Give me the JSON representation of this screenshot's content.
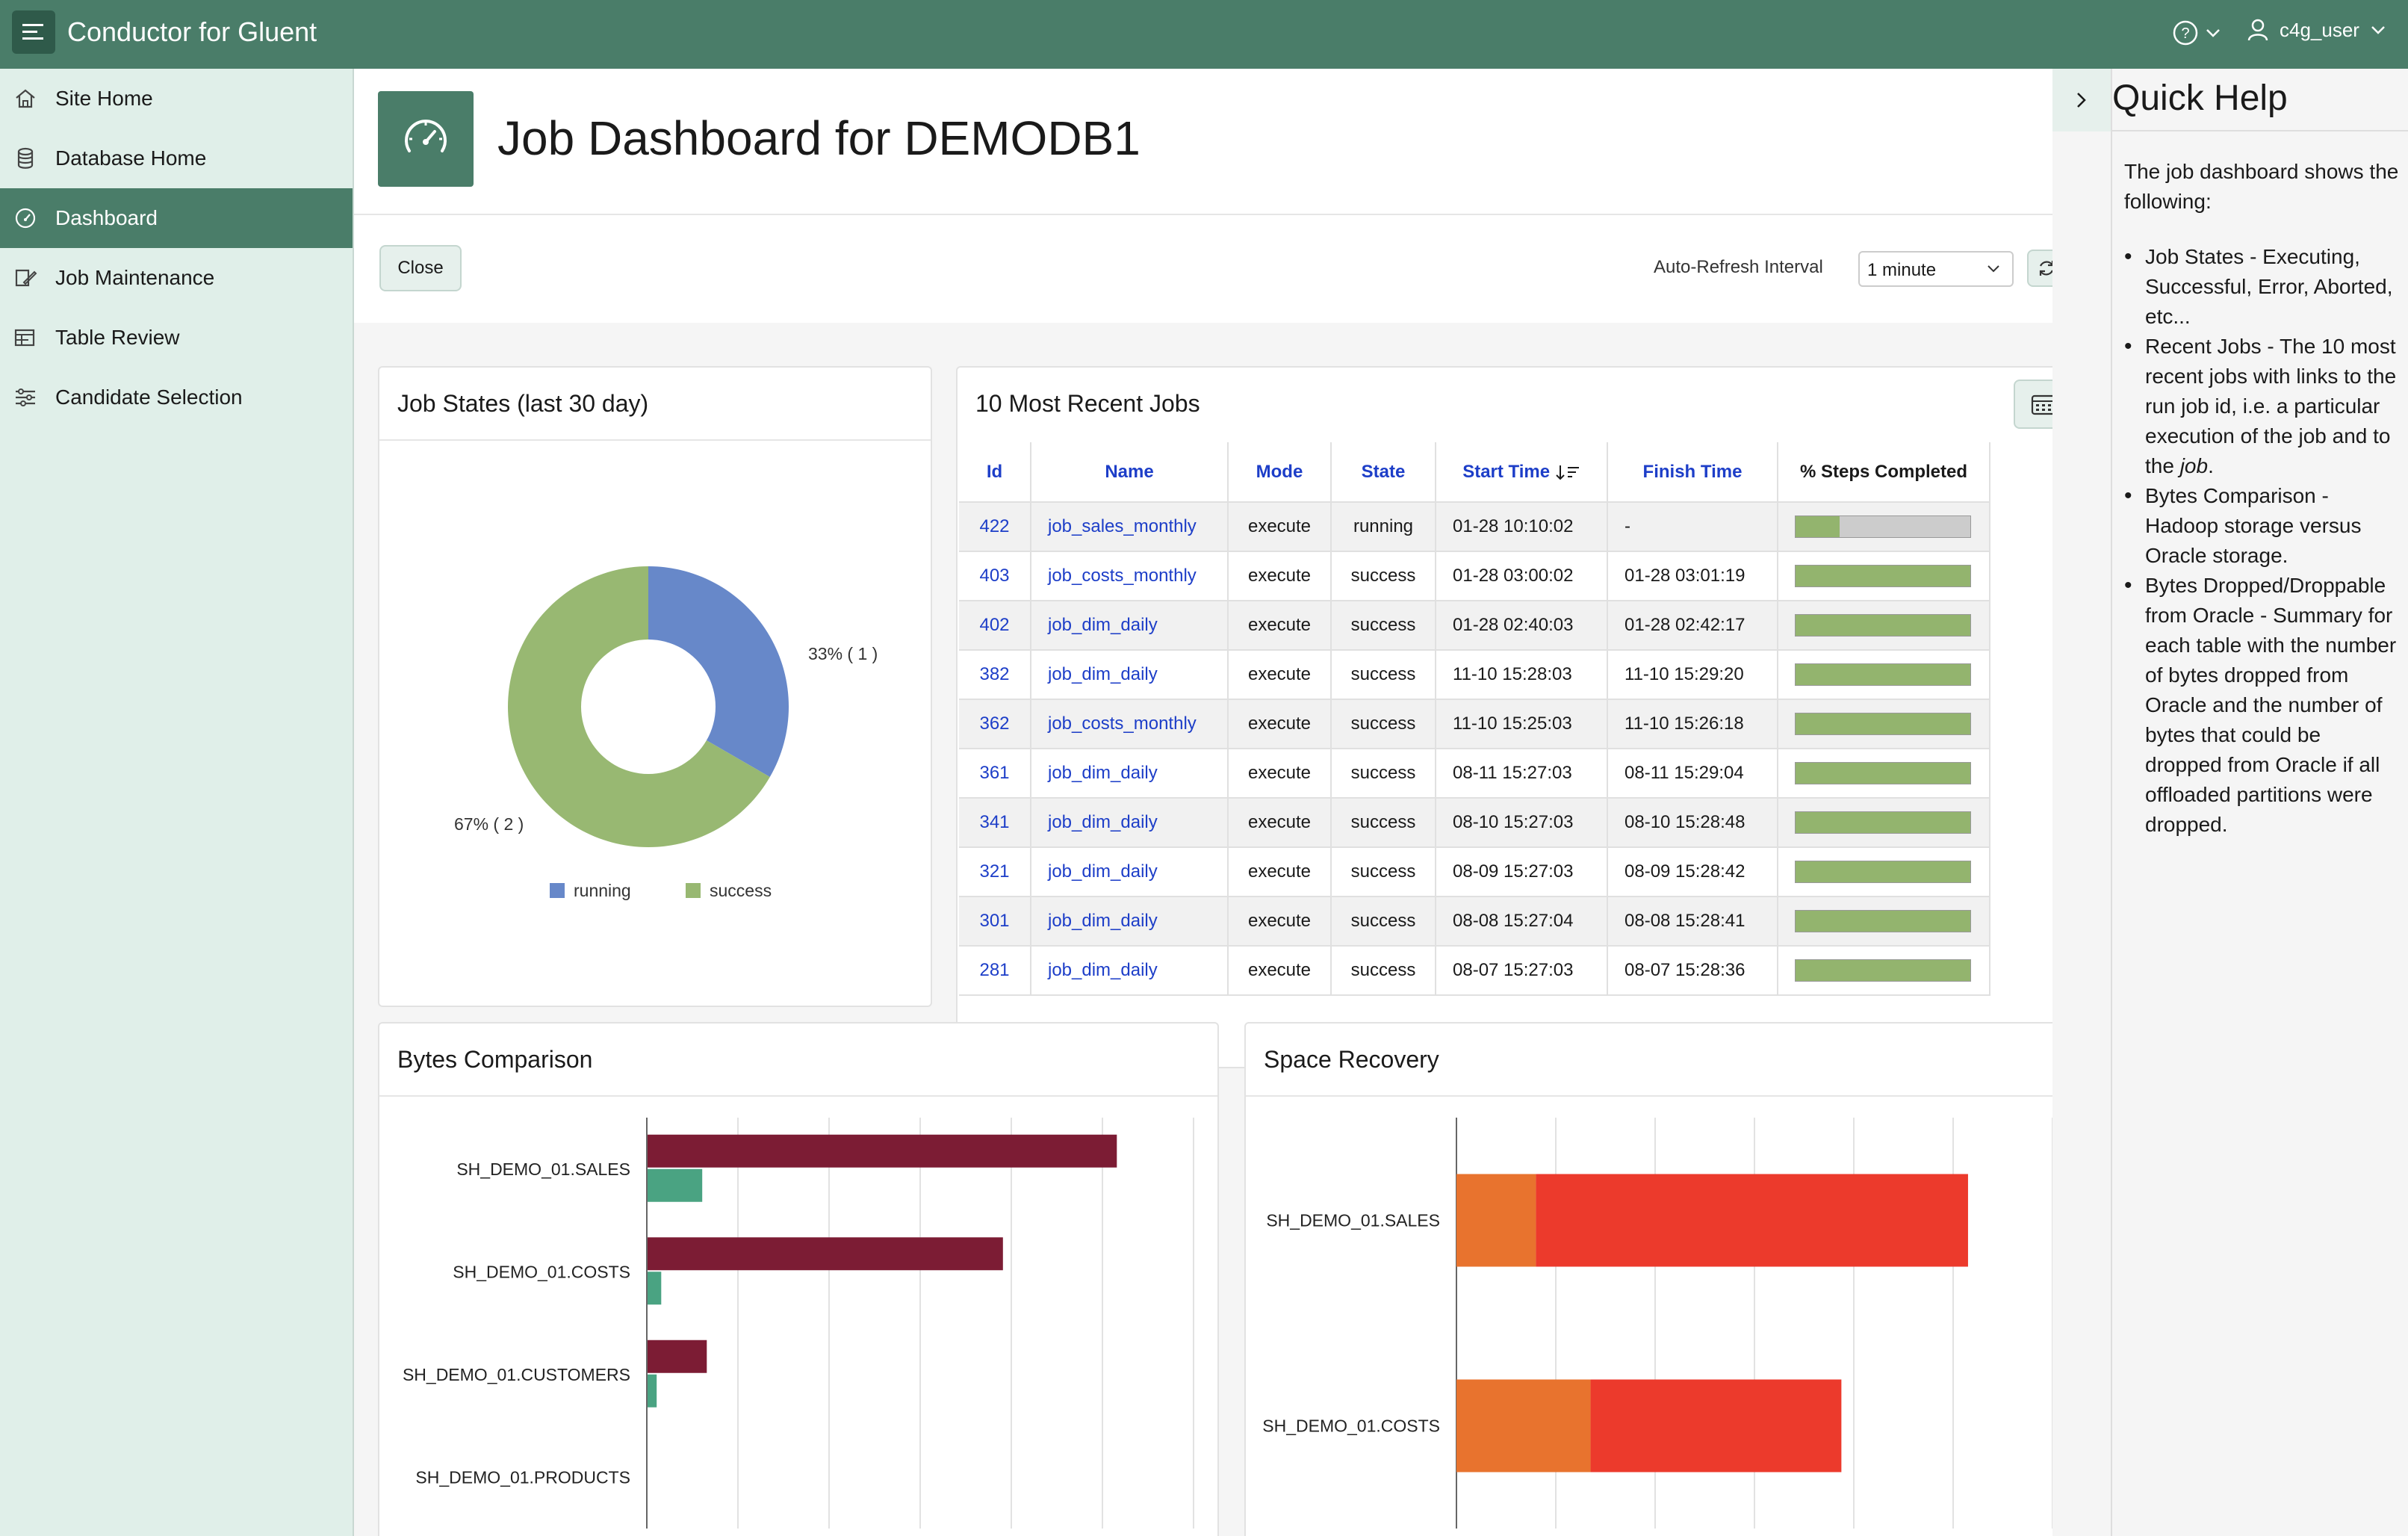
{
  "app": {
    "title": "Conductor for Gluent",
    "user": "c4g_user"
  },
  "sidebar": {
    "items": [
      {
        "label": "Site Home",
        "icon": "home-icon",
        "active": false
      },
      {
        "label": "Database Home",
        "icon": "database-icon",
        "active": false
      },
      {
        "label": "Dashboard",
        "icon": "dashboard-icon",
        "active": true
      },
      {
        "label": "Job Maintenance",
        "icon": "job-maintenance-icon",
        "active": false
      },
      {
        "label": "Table Review",
        "icon": "table-review-icon",
        "active": false
      },
      {
        "label": "Candidate Selection",
        "icon": "candidate-selection-icon",
        "active": false
      }
    ]
  },
  "page": {
    "title": "Job Dashboard for DEMODB1",
    "close_label": "Close",
    "refresh_label": "Auto-Refresh Interval",
    "refresh_value": "1 minute"
  },
  "job_states": {
    "title": "Job States (last 30 day)",
    "slices": [
      {
        "label": "running",
        "value": 1,
        "percent": 33,
        "color": "#6788c9",
        "text": "33% ( 1 )"
      },
      {
        "label": "success",
        "value": 2,
        "percent": 67,
        "color": "#98b872",
        "text": "67% ( 2 )"
      }
    ]
  },
  "recent_jobs": {
    "title": "10 Most Recent Jobs",
    "columns": [
      "Id",
      "Name",
      "Mode",
      "State",
      "Start Time",
      "Finish Time",
      "% Steps Completed"
    ],
    "rows": [
      {
        "id": "422",
        "name": "job_sales_monthly",
        "mode": "execute",
        "state": "running",
        "start": "01-28 10:10:02",
        "finish": "-",
        "pct": 0.25
      },
      {
        "id": "403",
        "name": "job_costs_monthly",
        "mode": "execute",
        "state": "success",
        "start": "01-28 03:00:02",
        "finish": "01-28 03:01:19",
        "pct": 1
      },
      {
        "id": "402",
        "name": "job_dim_daily",
        "mode": "execute",
        "state": "success",
        "start": "01-28 02:40:03",
        "finish": "01-28 02:42:17",
        "pct": 1
      },
      {
        "id": "382",
        "name": "job_dim_daily",
        "mode": "execute",
        "state": "success",
        "start": "11-10 15:28:03",
        "finish": "11-10 15:29:20",
        "pct": 1
      },
      {
        "id": "362",
        "name": "job_costs_monthly",
        "mode": "execute",
        "state": "success",
        "start": "11-10 15:25:03",
        "finish": "11-10 15:26:18",
        "pct": 1
      },
      {
        "id": "361",
        "name": "job_dim_daily",
        "mode": "execute",
        "state": "success",
        "start": "08-11 15:27:03",
        "finish": "08-11 15:29:04",
        "pct": 1
      },
      {
        "id": "341",
        "name": "job_dim_daily",
        "mode": "execute",
        "state": "success",
        "start": "08-10 15:27:03",
        "finish": "08-10 15:28:48",
        "pct": 1
      },
      {
        "id": "321",
        "name": "job_dim_daily",
        "mode": "execute",
        "state": "success",
        "start": "08-09 15:27:03",
        "finish": "08-09 15:28:42",
        "pct": 1
      },
      {
        "id": "301",
        "name": "job_dim_daily",
        "mode": "execute",
        "state": "success",
        "start": "08-08 15:27:04",
        "finish": "08-08 15:28:41",
        "pct": 1
      },
      {
        "id": "281",
        "name": "job_dim_daily",
        "mode": "execute",
        "state": "success",
        "start": "08-07 15:27:03",
        "finish": "08-07 15:28:36",
        "pct": 1
      }
    ]
  },
  "bytes_comparison": {
    "title": "Bytes Comparison"
  },
  "space_recovery": {
    "title": "Space Recovery"
  },
  "chart_data": [
    {
      "type": "pie",
      "title": "Job States (last 30 day)",
      "categories": [
        "running",
        "success"
      ],
      "values": [
        1,
        2
      ],
      "legend": "bottom"
    },
    {
      "type": "bar",
      "orientation": "horizontal",
      "title": "Bytes Comparison",
      "categories": [
        "SH_DEMO_01.SALES",
        "SH_DEMO_01.COSTS",
        "SH_DEMO_01.CUSTOMERS",
        "SH_DEMO_01.PRODUCTS"
      ],
      "series": [
        {
          "values": [
            103,
            78,
            13,
            0
          ],
          "color": "#7c1c34"
        },
        {
          "values": [
            12,
            3,
            2,
            0
          ],
          "color": "#4aa382"
        }
      ],
      "xlim": [
        0,
        120
      ],
      "xticks": [
        "0",
        "20M",
        "40M",
        "60M",
        "80M",
        "100M",
        "120M"
      ],
      "grid": true
    },
    {
      "type": "bar",
      "orientation": "horizontal",
      "stacked": true,
      "title": "Space Recovery",
      "categories": [
        "SH_DEMO_01.SALES",
        "SH_DEMO_01.COSTS"
      ],
      "series": [
        {
          "values": [
            16,
            27
          ],
          "color": "#e8732e"
        },
        {
          "values": [
            87,
            50.5
          ],
          "color": "#ec3a2c"
        }
      ],
      "xlim": [
        0,
        120
      ],
      "xticks": [
        "0",
        "20M",
        "40M",
        "60M",
        "80M",
        "100M",
        "120M"
      ],
      "grid": true
    }
  ],
  "quick_help": {
    "title": "Quick Help",
    "intro": "The job dashboard shows the following:",
    "items": [
      {
        "text": "Job States - Executing, Successful, Error, Aborted, etc..."
      },
      {
        "text": "Recent Jobs - The 10 most recent jobs with links to the run job id, i.e. a particular execution of the job and to the ",
        "em": "job",
        "tail": "."
      },
      {
        "text": "Bytes Comparison - Hadoop storage versus Oracle storage."
      },
      {
        "text": "Bytes Dropped/Droppable from Oracle - Summary for each table with the number of bytes dropped from Oracle and the number of bytes that could be dropped from Oracle if all offloaded partitions were dropped."
      }
    ]
  }
}
